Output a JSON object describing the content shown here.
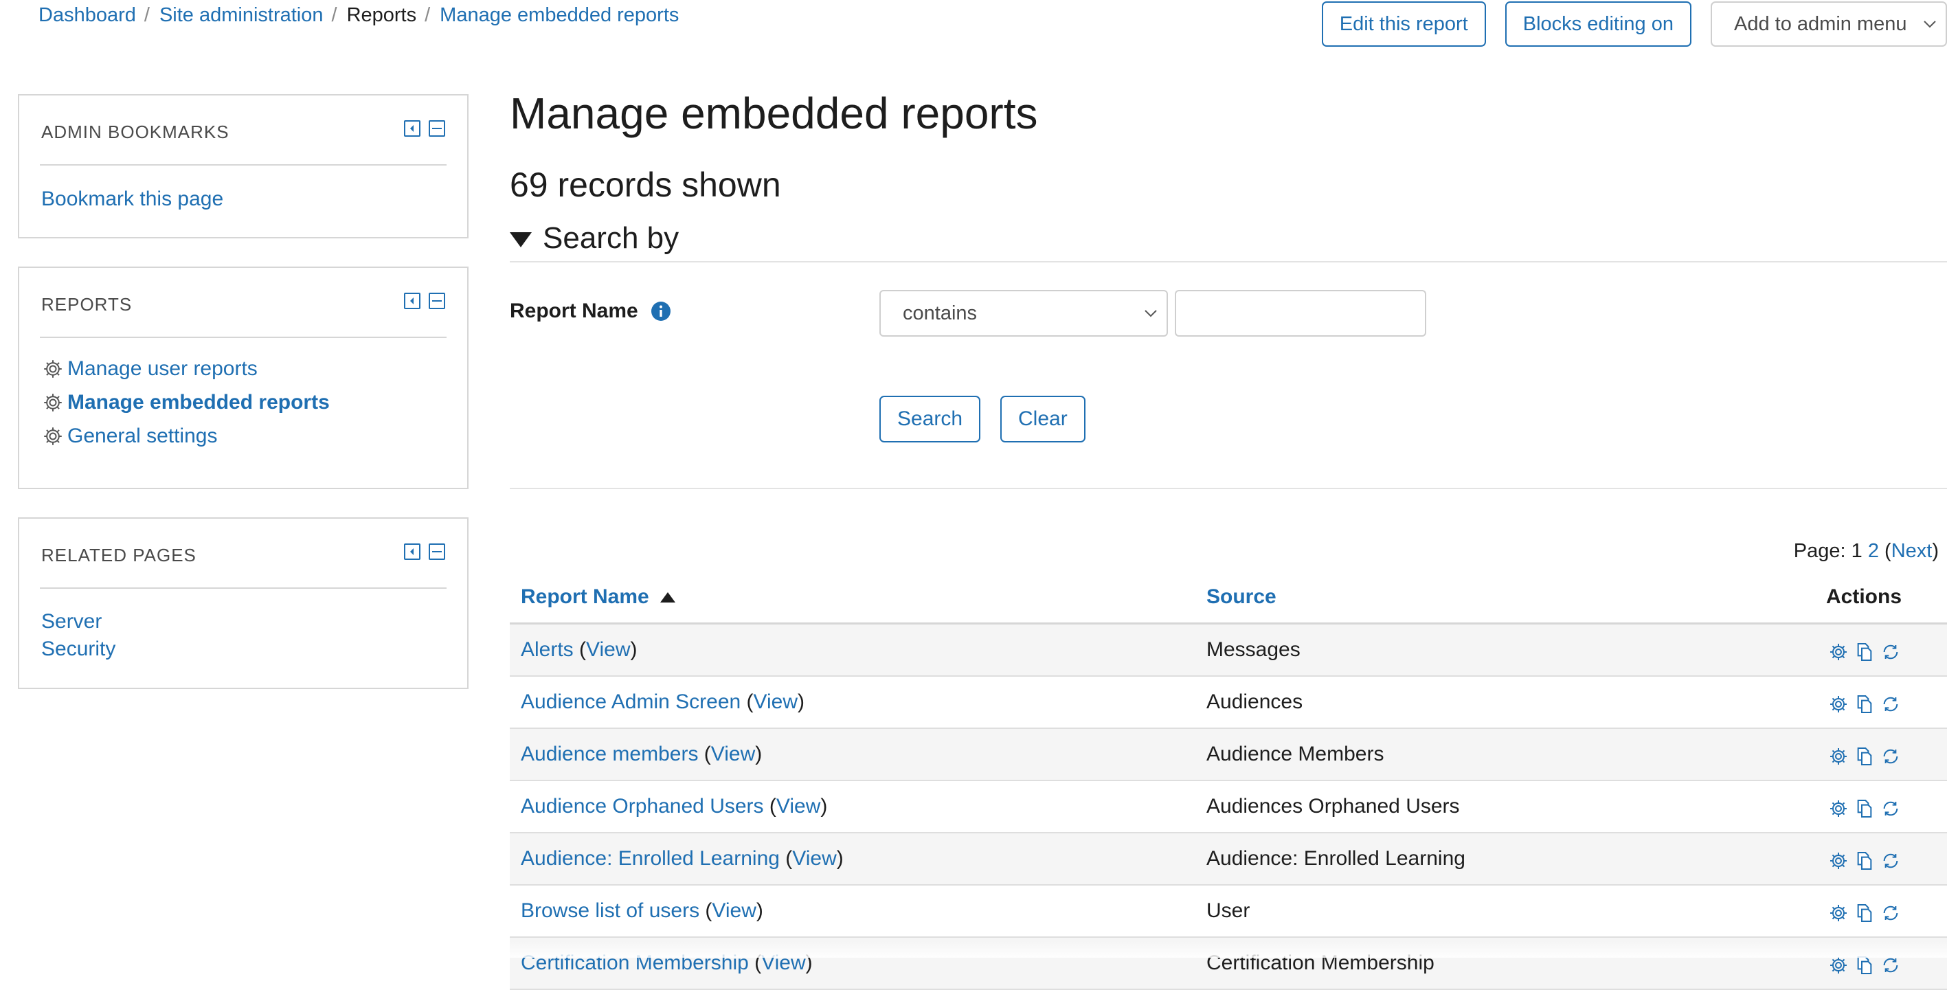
{
  "breadcrumb": [
    {
      "label": "Dashboard"
    },
    {
      "label": "Site administration"
    },
    {
      "label": "Reports"
    },
    {
      "label": "Manage embedded reports"
    }
  ],
  "header_buttons": {
    "edit_report": "Edit this report",
    "blocks_editing": "Blocks editing on",
    "admin_menu": "Add to admin menu"
  },
  "blocks": {
    "admin_bookmarks": {
      "title": "ADMIN BOOKMARKS",
      "link": "Bookmark this page"
    },
    "reports": {
      "title": "REPORTS",
      "items": [
        {
          "label": "Manage user reports",
          "icon": "gear-icon"
        },
        {
          "label": "Manage embedded reports",
          "icon": "gear-icon",
          "active": true
        },
        {
          "label": "General settings",
          "icon": "gear-icon"
        }
      ]
    },
    "related_pages": {
      "title": "RELATED PAGES",
      "items": [
        "Server",
        "Security"
      ]
    }
  },
  "main": {
    "title": "Manage embedded reports",
    "records": "69 records shown",
    "search_by": "Search by",
    "field_label": "Report Name",
    "operator": "contains",
    "search_value": "",
    "search_button": "Search",
    "clear_button": "Clear"
  },
  "pagination": {
    "prefix": "Page:",
    "current": "1",
    "next_page": "2",
    "next_label": "Next"
  },
  "table": {
    "columns": {
      "name": "Report Name",
      "source": "Source",
      "actions": "Actions"
    },
    "view_label": "View",
    "rows": [
      {
        "name": "Alerts",
        "source": "Messages"
      },
      {
        "name": "Audience Admin Screen",
        "source": "Audiences"
      },
      {
        "name": "Audience members",
        "source": "Audience Members"
      },
      {
        "name": "Audience Orphaned Users",
        "source": "Audiences Orphaned Users"
      },
      {
        "name": "Audience: Enrolled Learning",
        "source": "Audience: Enrolled Learning"
      },
      {
        "name": "Browse list of users",
        "source": "User"
      },
      {
        "name": "Certification Membership",
        "source": "Certification Membership"
      }
    ],
    "action_icons": [
      "settings-icon",
      "clone-icon",
      "reload-icon"
    ]
  },
  "colors": {
    "link": "#1f6fb2",
    "border": "#d6d6d6",
    "row_alt": "#f5f5f5"
  }
}
